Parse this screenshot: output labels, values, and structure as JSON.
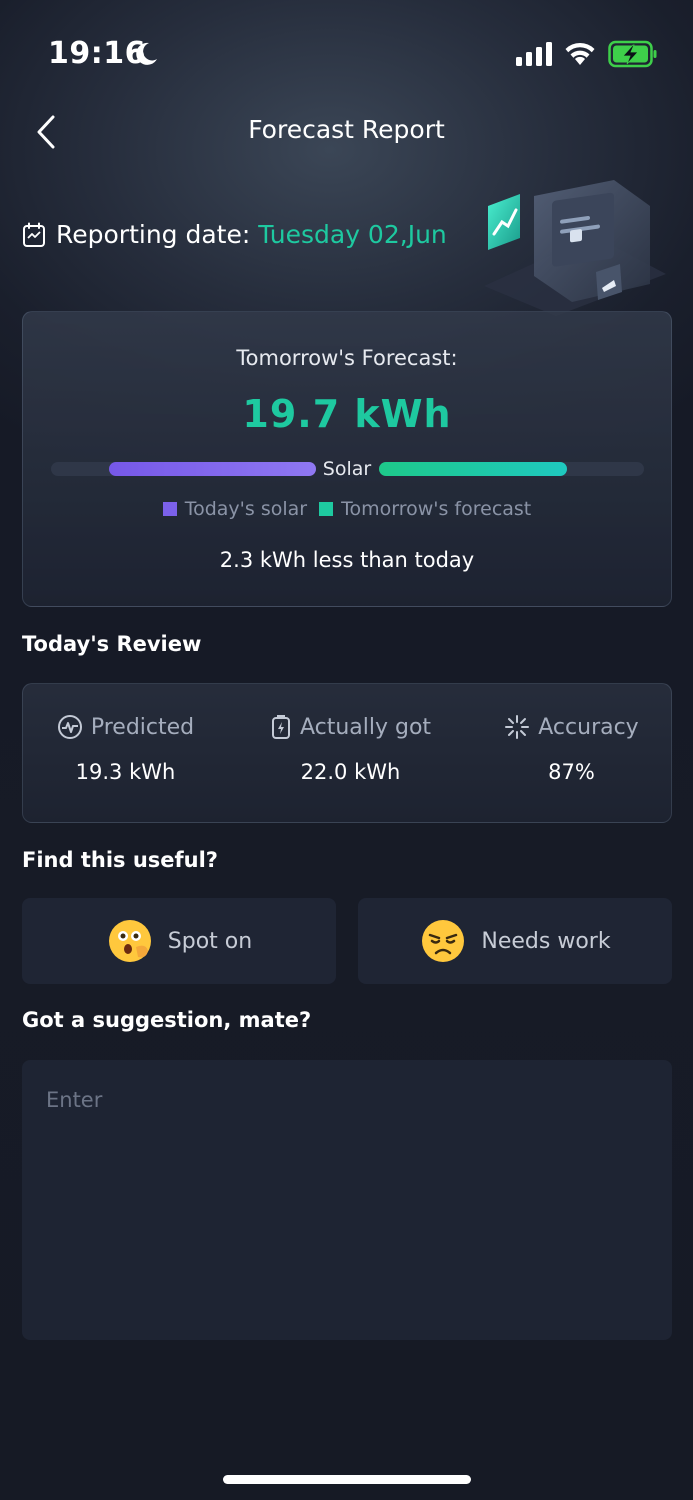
{
  "status_bar": {
    "time": "19:16"
  },
  "header": {
    "title": "Forecast Report"
  },
  "report": {
    "label": "Reporting date:",
    "date": "Tuesday 02,Jun"
  },
  "forecast": {
    "label": "Tomorrow's Forecast:",
    "value": "19.7 kWh",
    "bar_label": "Solar",
    "todays_solar_level": 0.78,
    "tomorrow_forecast_level": 0.71,
    "legend": [
      {
        "label": "Today's solar",
        "color": "#7b61ea"
      },
      {
        "label": "Tomorrow's forecast",
        "color": "#1ec9a0"
      }
    ],
    "comparison": "2.3 kWh less than today"
  },
  "review": {
    "title": "Today's Review",
    "items": [
      {
        "label": "Predicted",
        "value": "19.3 kWh",
        "icon": "pulse-icon"
      },
      {
        "label": "Actually got",
        "value": "22.0 kWh",
        "icon": "battery-bolt-icon"
      },
      {
        "label": "Accuracy",
        "value": "87%",
        "icon": "sparkle-icon"
      }
    ]
  },
  "feedback": {
    "title": "Find this useful?",
    "spot_on": "Spot on",
    "needs_work": "Needs work"
  },
  "suggestion": {
    "title": "Got a suggestion, mate?",
    "placeholder": "Enter"
  },
  "colors": {
    "accent": "#1ec9a0",
    "purple": "#7b61ea",
    "background": "#161a26"
  }
}
